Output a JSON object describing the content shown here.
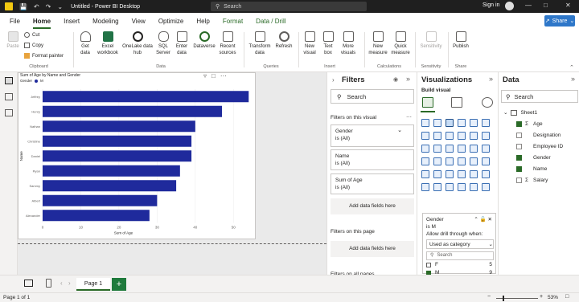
{
  "titlebar": {
    "doc_title": "Untitled - Power BI Desktop",
    "search_placeholder": "Search",
    "signin": "Sign in"
  },
  "menu": {
    "items": [
      "File",
      "Home",
      "Insert",
      "Modeling",
      "View",
      "Optimize",
      "Help",
      "Format",
      "Data / Drill"
    ],
    "active": "Home",
    "share_label": "Share"
  },
  "ribbon": {
    "clipboard": {
      "paste": "Paste",
      "cut": "Cut",
      "copy": "Copy",
      "format_painter": "Format painter",
      "group": "Clipboard"
    },
    "data": {
      "get_data": "Get data",
      "excel": "Excel workbook",
      "onelake": "OneLake data hub",
      "sql": "SQL Server",
      "enter": "Enter data",
      "dataverse": "Dataverse",
      "recent": "Recent sources",
      "group": "Data"
    },
    "queries": {
      "transform": "Transform data",
      "refresh": "Refresh",
      "group": "Queries"
    },
    "insert": {
      "new_visual": "New visual",
      "text_box": "Text box",
      "more_visuals": "More visuals",
      "group": "Insert"
    },
    "calculations": {
      "new_measure": "New measure",
      "quick_measure": "Quick measure",
      "group": "Calculations"
    },
    "sensitivity": {
      "label": "Sensitivity",
      "group": "Sensitivity"
    },
    "share": {
      "publish": "Publish",
      "group": "Share"
    }
  },
  "chart_data": {
    "type": "bar",
    "orientation": "horizontal",
    "title": "Sum of Age by Name and Gender",
    "legend": {
      "title": "Gender",
      "entries": [
        "M"
      ]
    },
    "categories": [
      "Jeffrey",
      "Henry",
      "Nathan",
      "Christine",
      "Daniel",
      "Ryan",
      "Sammy",
      "Albert",
      "Alexander"
    ],
    "values": [
      54,
      47,
      40,
      39,
      39,
      36,
      35,
      30,
      28
    ],
    "xlabel": "Sum of Age",
    "ylabel": "Name",
    "xticks": [
      0,
      10,
      20,
      30,
      40,
      50
    ],
    "xlim": [
      0,
      55
    ],
    "color": "#1f2a9c"
  },
  "filters": {
    "title": "Filters",
    "search_placeholder": "Search",
    "on_visual": "Filters on this visual",
    "cards": [
      {
        "name": "Gender",
        "value": "is (All)"
      },
      {
        "name": "Name",
        "value": "is (All)"
      },
      {
        "name": "Sum of Age",
        "value": "is (All)"
      }
    ],
    "add_fields": "Add data fields here",
    "on_page": "Filters on this page",
    "add_fields_page": "Add data fields here",
    "on_all": "Filters on all pages"
  },
  "visualizations": {
    "title": "Visualizations",
    "build": "Build visual",
    "drill": {
      "field": "Gender",
      "value": "is M",
      "allow": "Allow drill through when:",
      "used_as": "Used as category",
      "search": "Search",
      "options": [
        {
          "label": "F",
          "count": "5",
          "checked": false
        },
        {
          "label": "M",
          "count": "9",
          "checked": true
        }
      ]
    }
  },
  "data_pane": {
    "title": "Data",
    "search_placeholder": "Search",
    "table": "Sheet1",
    "fields": [
      {
        "name": "Age",
        "sigma": true,
        "checked": true
      },
      {
        "name": "Designation",
        "sigma": false,
        "checked": false
      },
      {
        "name": "Employee ID",
        "sigma": false,
        "checked": false
      },
      {
        "name": "Gender",
        "sigma": false,
        "checked": true
      },
      {
        "name": "Name",
        "sigma": false,
        "checked": true
      },
      {
        "name": "Salary",
        "sigma": true,
        "checked": false
      }
    ]
  },
  "pages": {
    "tab": "Page 1",
    "add": "+"
  },
  "status": {
    "page_info": "Page 1 of 1",
    "zoom": "53%"
  }
}
